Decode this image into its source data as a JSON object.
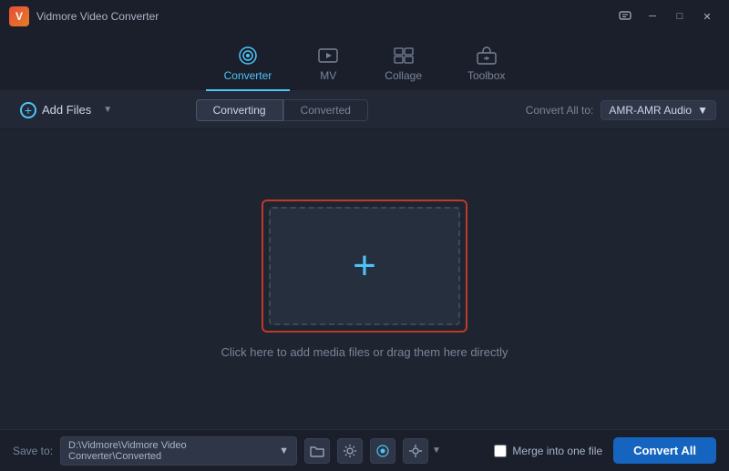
{
  "titleBar": {
    "appName": "Vidmore Video Converter",
    "controls": {
      "message": "💬",
      "minimize": "─",
      "maximize": "□",
      "close": "✕"
    }
  },
  "nav": {
    "tabs": [
      {
        "id": "converter",
        "label": "Converter",
        "icon": "⊙",
        "active": true
      },
      {
        "id": "mv",
        "label": "MV",
        "icon": "🖼",
        "active": false
      },
      {
        "id": "collage",
        "label": "Collage",
        "icon": "⊞",
        "active": false
      },
      {
        "id": "toolbox",
        "label": "Toolbox",
        "icon": "🧰",
        "active": false
      }
    ]
  },
  "toolbar": {
    "addFiles": "Add Files",
    "converting": "Converting",
    "converted": "Converted",
    "convertAllTo": "Convert All to:",
    "formatValue": "AMR-AMR Audio"
  },
  "mainArea": {
    "dropHint": "Click here to add media files or drag them here directly"
  },
  "footer": {
    "saveTo": "Save to:",
    "savePath": "D:\\Vidmore\\Vidmore Video Converter\\Converted",
    "mergeLabel": "Merge into one file",
    "convertAllLabel": "Convert All"
  }
}
